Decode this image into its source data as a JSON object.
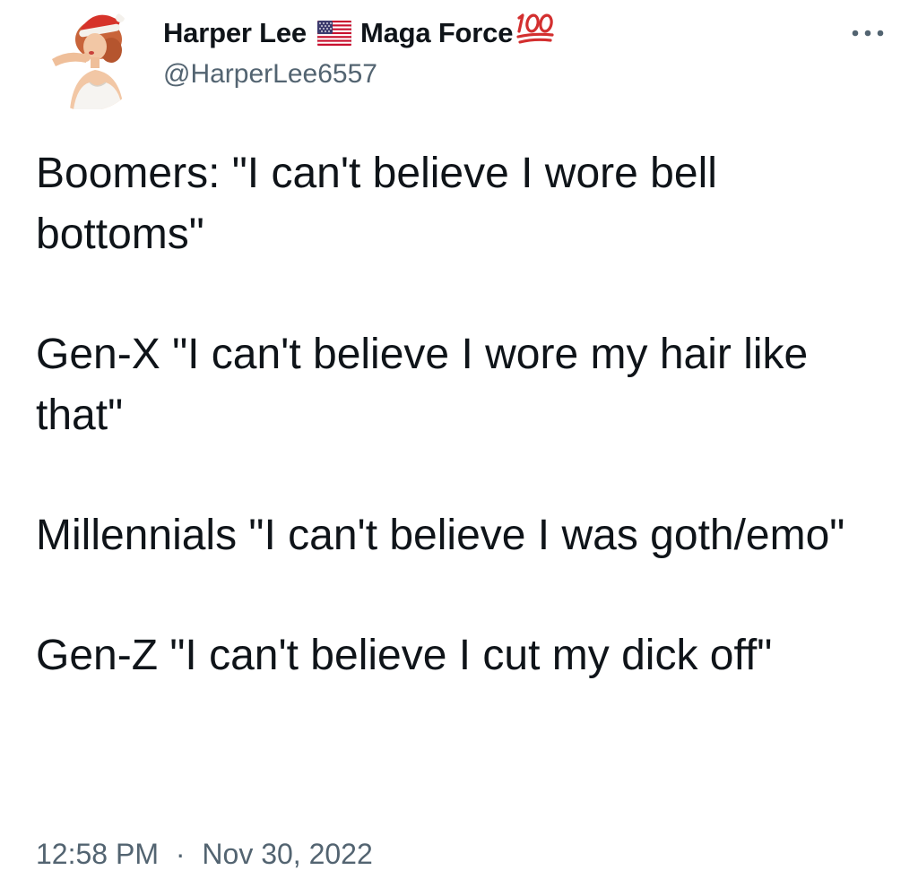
{
  "author": {
    "display_name_part1": "Harper Lee",
    "flag_icon": "us-flag-icon",
    "display_name_part2": "Maga Force",
    "badge_icon": "hundred-points-icon",
    "handle": "@HarperLee6557",
    "avatar_icon": "pinup-santa-hat-avatar"
  },
  "more_icon": "more-options-icon",
  "tweet": {
    "paragraphs": [
      "Boomers: \"I can't believe I wore bell bottoms\"",
      "Gen-X \"I can't believe I wore my hair like that\"",
      "Millennials \"I can't believe I was goth/emo\"",
      "Gen-Z \"I can't believe I cut my dick off\""
    ]
  },
  "meta": {
    "time": "12:58 PM",
    "separator": "·",
    "date": "Nov 30, 2022"
  },
  "colors": {
    "primary_text": "#0f1419",
    "secondary_text": "#536471",
    "hundred_red": "#d32f2f"
  }
}
